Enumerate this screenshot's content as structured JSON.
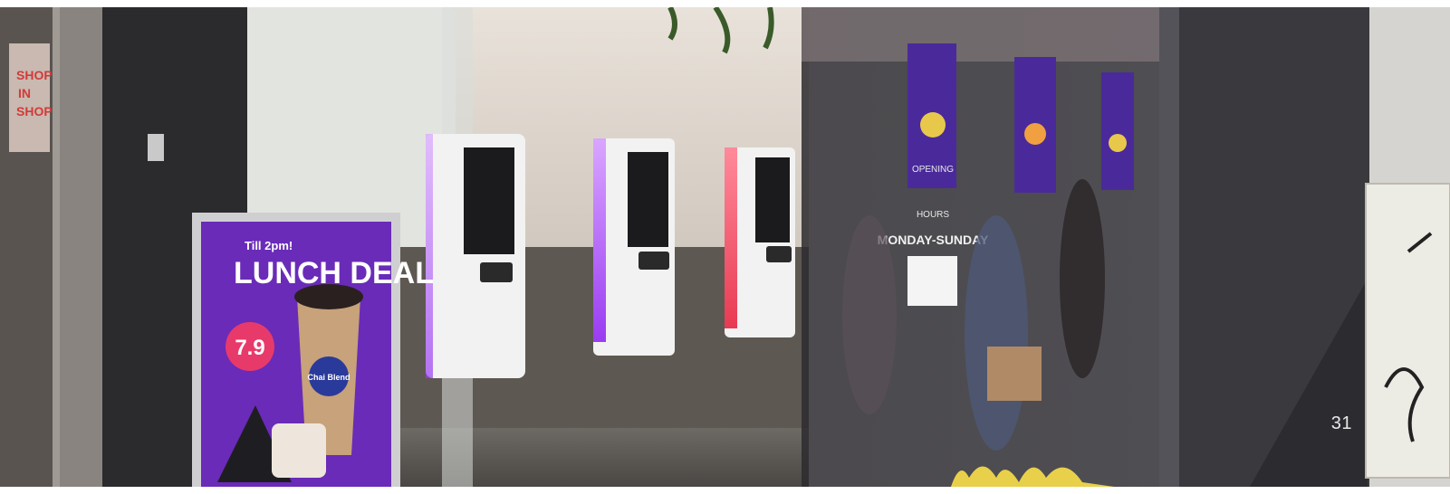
{
  "page_number": "31",
  "poster": {
    "subtitle": "Till 2pm!",
    "headline": "LUNCH DEAL",
    "price": "7.9",
    "cup_brand": "Chai Blend"
  },
  "window_decal": {
    "hours_label": "HOURS",
    "days": "MONDAY-SUNDAY",
    "left_word": "OPENING"
  },
  "colors": {
    "poster_purple": "#6a2bb8",
    "price_badge": "#e83a6a",
    "kiosk_white": "#f2f2f2",
    "light_purple": "#b46cff",
    "light_red": "#ff4d6a"
  }
}
